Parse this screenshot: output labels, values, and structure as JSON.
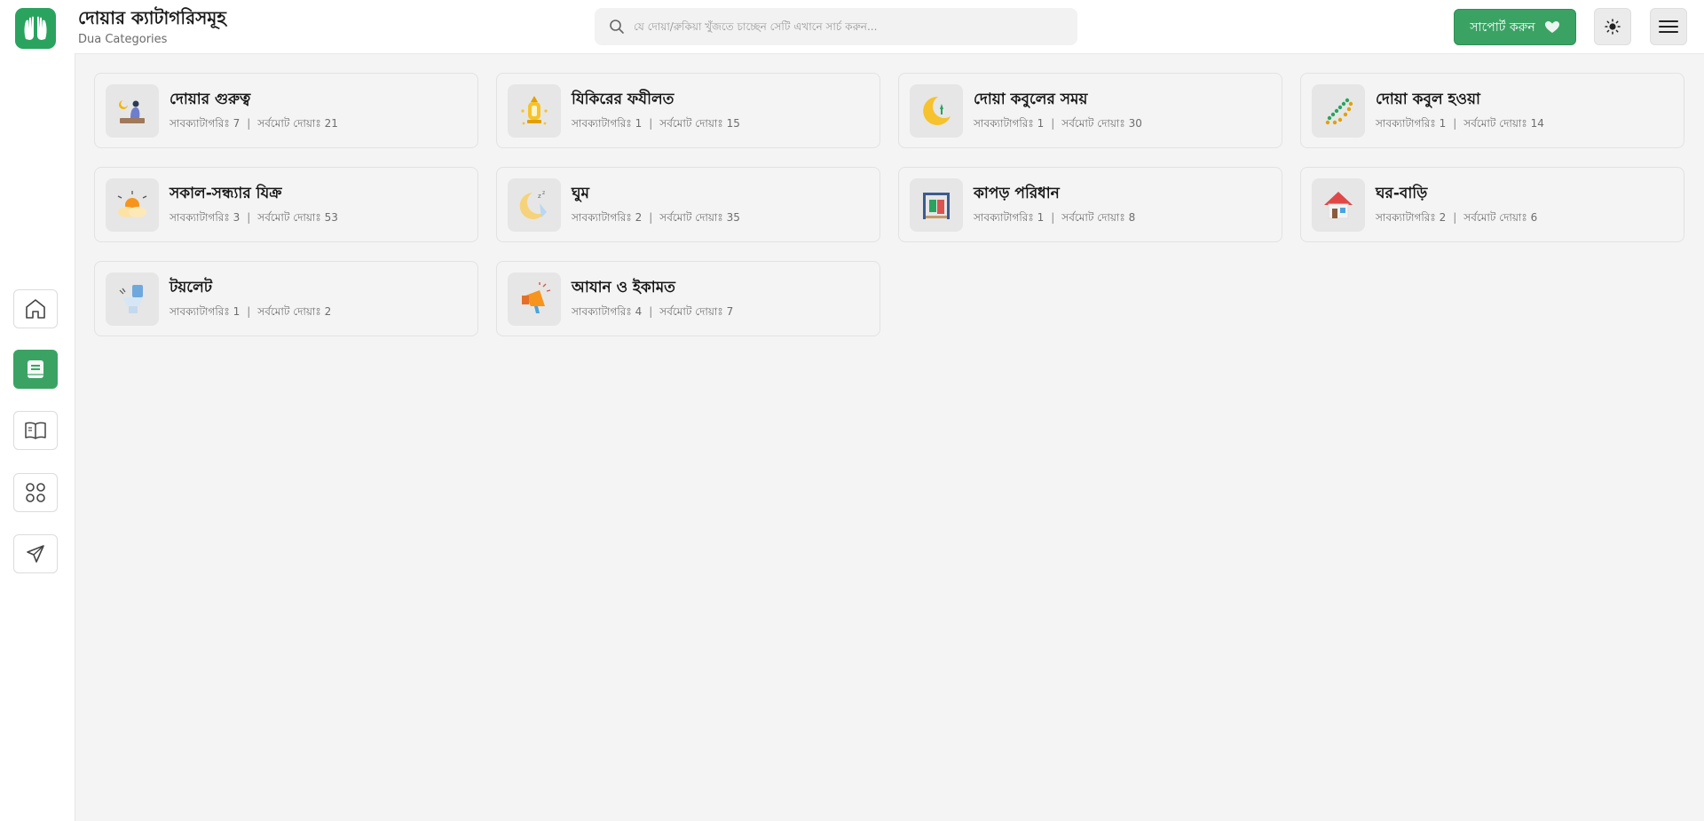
{
  "header": {
    "title": "দোয়ার ক্যাটাগরিসমূহ",
    "subtitle": "Dua Categories",
    "search_placeholder": "যে দোয়া/রুকিয়া খুঁজতে চাচ্ছেন সেটি এখানে সার্চ করুন...",
    "support_label": "সাপোর্ট করুন"
  },
  "sidebar": {
    "items": [
      {
        "name": "home",
        "icon": "home-icon"
      },
      {
        "name": "dua",
        "icon": "book-note-icon",
        "active": true
      },
      {
        "name": "reader",
        "icon": "open-book-icon"
      },
      {
        "name": "apps",
        "icon": "grid-icon"
      },
      {
        "name": "send",
        "icon": "send-icon"
      }
    ]
  },
  "colors": {
    "accent": "#3aa364",
    "background": "#f4f4f4"
  },
  "categories": [
    {
      "name": "দোয়ার গুরুত্ব",
      "sub_label": "সাবক্যাটাগরিঃ",
      "sub": "7",
      "total_label": "সর্বমোট দোয়াঃ",
      "total": "21",
      "icon": "prayer-mat-icon"
    },
    {
      "name": "যিকিরের ফযীলত",
      "sub_label": "সাবক্যাটাগরিঃ",
      "sub": "1",
      "total_label": "সর্বমোট দোয়াঃ",
      "total": "15",
      "icon": "lantern-icon"
    },
    {
      "name": "দোয়া কবুলের সময়",
      "sub_label": "সাবক্যাটাগরিঃ",
      "sub": "1",
      "total_label": "সর্বমোট দোয়াঃ",
      "total": "30",
      "icon": "crescent-moon-icon"
    },
    {
      "name": "দোয়া কবুল হওয়া",
      "sub_label": "সাবক্যাটাগরিঃ",
      "sub": "1",
      "total_label": "সর্বমোট দোয়াঃ",
      "total": "14",
      "icon": "tasbih-beads-icon"
    },
    {
      "name": "সকাল-সন্ধ্যার যিক্র",
      "sub_label": "সাবক্যাটাগরিঃ",
      "sub": "3",
      "total_label": "সর্বমোট দোয়াঃ",
      "total": "53",
      "icon": "sunrise-icon"
    },
    {
      "name": "ঘুম",
      "sub_label": "সাবক্যাটাগরিঃ",
      "sub": "2",
      "total_label": "সর্বমোট দোয়াঃ",
      "total": "35",
      "icon": "sleep-moon-icon"
    },
    {
      "name": "কাপড় পরিধান",
      "sub_label": "সাবক্যাটাগরিঃ",
      "sub": "1",
      "total_label": "সর্বমোট দোয়াঃ",
      "total": "8",
      "icon": "clothes-rack-icon"
    },
    {
      "name": "ঘর-বাড়ি",
      "sub_label": "সাবক্যাটাগরিঃ",
      "sub": "2",
      "total_label": "সর্বমোট দোয়াঃ",
      "total": "6",
      "icon": "house-icon"
    },
    {
      "name": "টয়লেট",
      "sub_label": "সাবক্যাটাগরিঃ",
      "sub": "1",
      "total_label": "সর্বমোট দোয়াঃ",
      "total": "2",
      "icon": "toilet-icon"
    },
    {
      "name": "আযান ও ইকামত",
      "sub_label": "সাবক্যাটাগরিঃ",
      "sub": "4",
      "total_label": "সর্বমোট দোয়াঃ",
      "total": "7",
      "icon": "megaphone-icon"
    }
  ]
}
